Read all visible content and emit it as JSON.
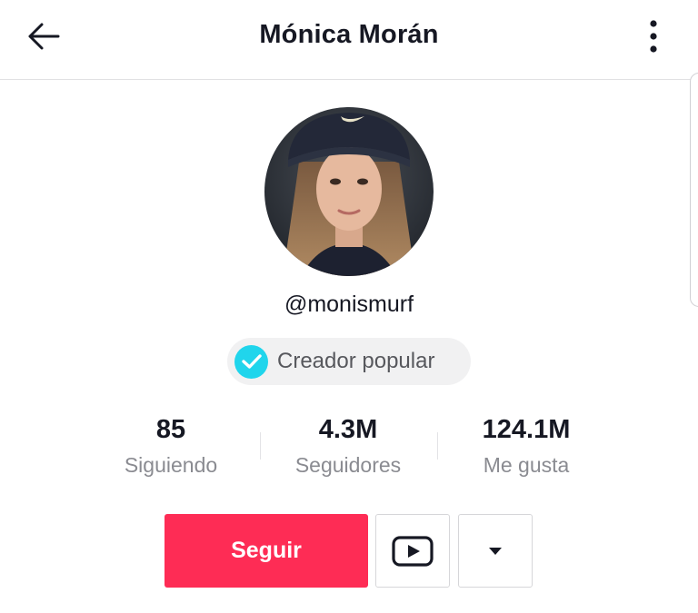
{
  "header": {
    "title": "Mónica Morán",
    "back_icon": "arrow-left-icon",
    "more_icon": "vertical-dots-icon"
  },
  "profile": {
    "avatar_alt": "profile-photo",
    "username": "@monismurf",
    "badge": {
      "label": "Creador popular",
      "icon": "checkmark-icon",
      "color": "#20d5ec"
    }
  },
  "stats": [
    {
      "value": "85",
      "label": "Siguiendo"
    },
    {
      "value": "4.3M",
      "label": "Seguidores"
    },
    {
      "value": "124.1M",
      "label": "Me gusta"
    }
  ],
  "actions": {
    "follow_label": "Seguir",
    "follow_color": "#fe2c55",
    "youtube_icon": "youtube-icon",
    "dropdown_icon": "caret-down-icon"
  }
}
